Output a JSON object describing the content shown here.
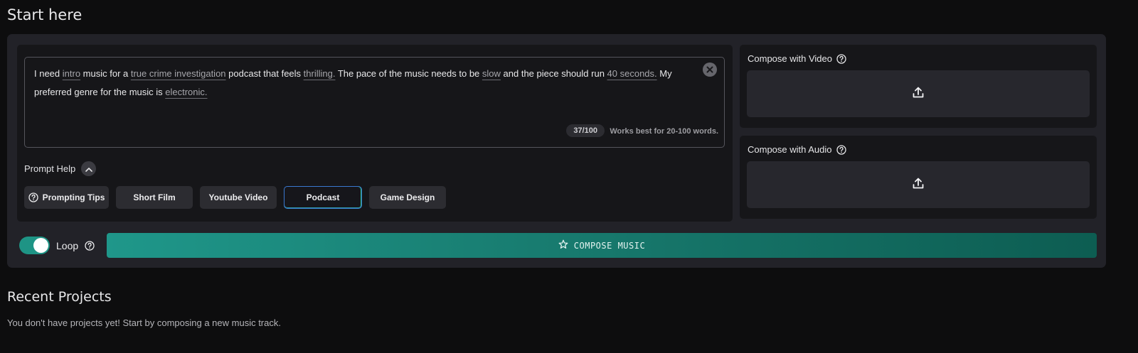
{
  "sections": {
    "start_title": "Start here",
    "recent_title": "Recent Projects",
    "empty_message": "You don't have projects yet! Start by composing a new music track."
  },
  "prompt": {
    "segments": [
      {
        "text": "I need ",
        "keyword": false
      },
      {
        "text": "intro",
        "keyword": true
      },
      {
        "text": " music for a ",
        "keyword": false
      },
      {
        "text": "true crime investigation",
        "keyword": true
      },
      {
        "text": " podcast that feels ",
        "keyword": false
      },
      {
        "text": "thrilling.",
        "keyword": true
      },
      {
        "text": " The pace of the music needs to be ",
        "keyword": false
      },
      {
        "text": "slow",
        "keyword": true
      },
      {
        "text": " and the piece should run ",
        "keyword": false
      },
      {
        "text": "40 seconds.",
        "keyword": true
      },
      {
        "text": " My preferred genre for the music is ",
        "keyword": false
      },
      {
        "text": "electronic.",
        "keyword": true
      }
    ],
    "word_count": "37/100",
    "hint": "Works best for 20-100 words.",
    "clear_icon": "close-icon"
  },
  "prompt_help": {
    "label": "Prompt Help",
    "toggle_icon": "chevron-up-icon",
    "chips": [
      {
        "label": "Prompting Tips",
        "icon": "question-circle-icon",
        "selected": false
      },
      {
        "label": "Short Film",
        "selected": false
      },
      {
        "label": "Youtube Video",
        "selected": false
      },
      {
        "label": "Podcast",
        "selected": true
      },
      {
        "label": "Game Design",
        "selected": false
      }
    ]
  },
  "uploads": {
    "video": {
      "title": "Compose with Video",
      "icon": "upload-icon"
    },
    "audio": {
      "title": "Compose with Audio",
      "icon": "upload-icon"
    }
  },
  "loop": {
    "label": "Loop",
    "enabled": true
  },
  "compose_button": {
    "label": "COMPOSE MUSIC",
    "icon": "sparkle-star-icon"
  },
  "colors": {
    "background": "#0d0d0e",
    "panel": "#222228",
    "card": "#161619",
    "accent_start": "#1f978a",
    "accent_end": "#0d5d52",
    "toggle_on": "#1e9485",
    "selected_chip_border": "#3a78d0"
  }
}
